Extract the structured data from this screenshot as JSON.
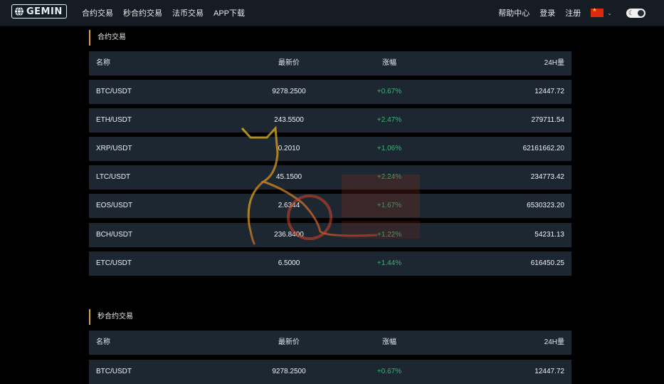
{
  "brand": {
    "logo_text": "GEMIN"
  },
  "nav": {
    "links": [
      "合约交易",
      "秒合约交易",
      "法币交易",
      "APP下载"
    ],
    "right": {
      "help": "帮助中心",
      "login": "登录",
      "register": "注册"
    }
  },
  "contract": {
    "title": "合约交易",
    "headers": {
      "name": "名称",
      "price": "最新价",
      "change": "涨幅",
      "volume": "24H量"
    },
    "rows": [
      {
        "name": "BTC/USDT",
        "price": "9278.2500",
        "change": "+0.67%",
        "volume": "12447.72"
      },
      {
        "name": "ETH/USDT",
        "price": "243.5500",
        "change": "+2.47%",
        "volume": "279711.54"
      },
      {
        "name": "XRP/USDT",
        "price": "0.2010",
        "change": "+1.06%",
        "volume": "62161662.20"
      },
      {
        "name": "LTC/USDT",
        "price": "45.1500",
        "change": "+2.24%",
        "volume": "234773.42"
      },
      {
        "name": "EOS/USDT",
        "price": "2.6344",
        "change": "+1.67%",
        "volume": "6530323.20"
      },
      {
        "name": "BCH/USDT",
        "price": "236.8400",
        "change": "+1.22%",
        "volume": "54231.13"
      },
      {
        "name": "ETC/USDT",
        "price": "6.5000",
        "change": "+1.44%",
        "volume": "616450.25"
      }
    ]
  },
  "second_contract": {
    "title": "秒合约交易",
    "headers": {
      "name": "名称",
      "price": "最新价",
      "change": "涨幅",
      "volume": "24H量"
    },
    "rows": [
      {
        "name": "BTC/USDT",
        "price": "9278.2500",
        "change": "+0.67%",
        "volume": "12447.72"
      }
    ]
  },
  "colors": {
    "accent": "#d9a23d",
    "positive": "#3fb07a",
    "row_bg": "#1d2731",
    "nav_bg": "#151c24"
  },
  "icons": {
    "logo": "globe-icon",
    "flag": "china-flag-icon",
    "theme": "theme-toggle-icon"
  }
}
